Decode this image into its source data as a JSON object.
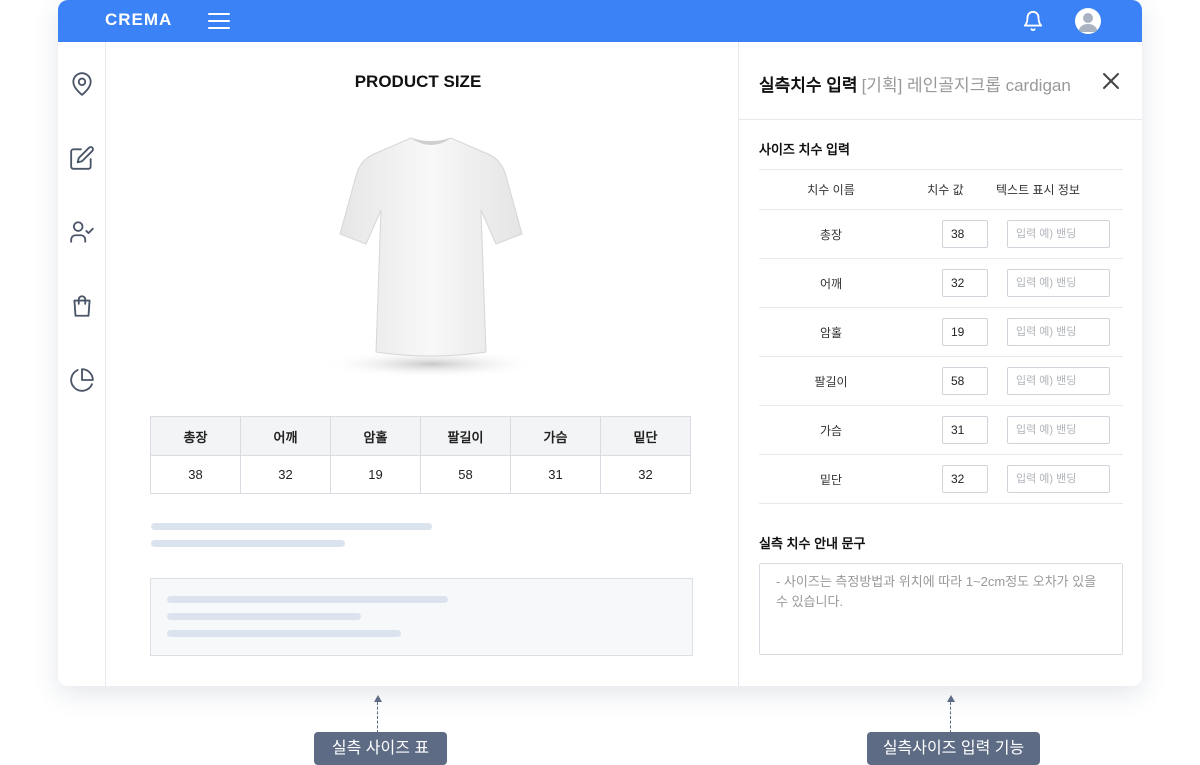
{
  "header": {
    "brand": "CREMA"
  },
  "preview": {
    "title": "PRODUCT SIZE",
    "size_table": {
      "headers": [
        "총장",
        "어깨",
        "암홀",
        "팔길이",
        "가슴",
        "밑단"
      ],
      "values": [
        "38",
        "32",
        "19",
        "58",
        "31",
        "32"
      ]
    }
  },
  "panel": {
    "title": "실측치수 입력",
    "product_name": "[기획] 레인골지크롭 cardigan",
    "size_section_title": "사이즈 치수 입력",
    "columns": [
      "치수 이름",
      "치수 값",
      "텍스트 표시 정보"
    ],
    "rows": [
      {
        "name": "총장",
        "value": "38"
      },
      {
        "name": "어깨",
        "value": "32"
      },
      {
        "name": "암홀",
        "value": "19"
      },
      {
        "name": "팔길이",
        "value": "58"
      },
      {
        "name": "가슴",
        "value": "31"
      },
      {
        "name": "밑단",
        "value": "32"
      }
    ],
    "text_placeholder": "입력 예) 밴딩",
    "guide_section_title": "실측 치수 안내 문구",
    "guide_text": "- 사이즈는 측정방법과 위치에 따라 1~2cm정도 오차가 있을 수 있습니다."
  },
  "callouts": {
    "left": "실측 사이즈 표",
    "right": "실측사이즈 입력 기능"
  },
  "colors": {
    "primary": "#3b82f6",
    "callout": "#5d6b85",
    "skeleton": "#dbe4ee"
  },
  "icons": {
    "sidebar": [
      "location-pin-icon",
      "edit-icon",
      "user-check-icon",
      "shopping-bag-icon",
      "pie-chart-icon"
    ],
    "header": [
      "menu-icon",
      "bell-icon",
      "user-avatar-icon"
    ]
  }
}
